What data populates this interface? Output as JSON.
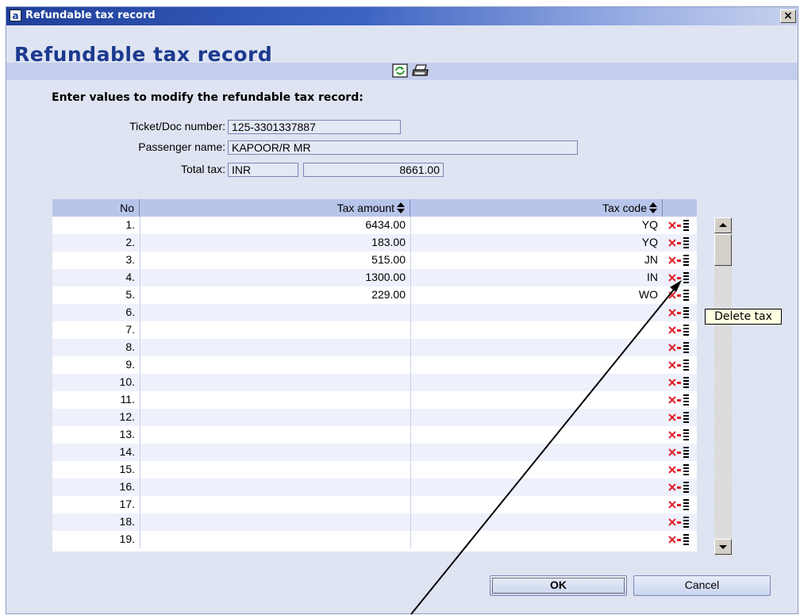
{
  "window": {
    "title": "Refundable tax record",
    "close_label": "×"
  },
  "page": {
    "heading": "Refundable tax record",
    "instructions": "Enter values to modify the refundable tax record:"
  },
  "form": {
    "ticket_label": "Ticket/Doc number:",
    "ticket_value": "125-3301337887",
    "passenger_label": "Passenger name:",
    "passenger_value": "KAPOOR/R MR",
    "total_tax_label": "Total tax:",
    "currency_value": "INR",
    "total_tax_value": "8661.00"
  },
  "table": {
    "headers": {
      "no": "No",
      "amount": "Tax amount",
      "code": "Tax code"
    },
    "rows": [
      {
        "no": "1.",
        "amount": "6434.00",
        "code": "YQ"
      },
      {
        "no": "2.",
        "amount": "183.00",
        "code": "YQ"
      },
      {
        "no": "3.",
        "amount": "515.00",
        "code": "JN"
      },
      {
        "no": "4.",
        "amount": "1300.00",
        "code": "IN"
      },
      {
        "no": "5.",
        "amount": "229.00",
        "code": "WO"
      },
      {
        "no": "6.",
        "amount": "",
        "code": ""
      },
      {
        "no": "7.",
        "amount": "",
        "code": ""
      },
      {
        "no": "8.",
        "amount": "",
        "code": ""
      },
      {
        "no": "9.",
        "amount": "",
        "code": ""
      },
      {
        "no": "10.",
        "amount": "",
        "code": ""
      },
      {
        "no": "11.",
        "amount": "",
        "code": ""
      },
      {
        "no": "12.",
        "amount": "",
        "code": ""
      },
      {
        "no": "13.",
        "amount": "",
        "code": ""
      },
      {
        "no": "14.",
        "amount": "",
        "code": ""
      },
      {
        "no": "15.",
        "amount": "",
        "code": ""
      },
      {
        "no": "16.",
        "amount": "",
        "code": ""
      },
      {
        "no": "17.",
        "amount": "",
        "code": ""
      },
      {
        "no": "18.",
        "amount": "",
        "code": ""
      },
      {
        "no": "19.",
        "amount": "",
        "code": ""
      }
    ]
  },
  "tooltip": {
    "text": "Delete tax"
  },
  "buttons": {
    "ok": "OK",
    "cancel": "Cancel"
  },
  "icons": {
    "refresh": "refresh-icon",
    "print": "printer-icon",
    "delete": "delete-tax-icon",
    "sort": "sort-icon"
  },
  "colors": {
    "title_bar": "#1e3f9a",
    "heading": "#1b3a8f",
    "header_band": "#c4cdec",
    "grid_header": "#b8c5ea",
    "delete_x": "#e0202a",
    "tooltip_bg": "#ffffe1"
  }
}
